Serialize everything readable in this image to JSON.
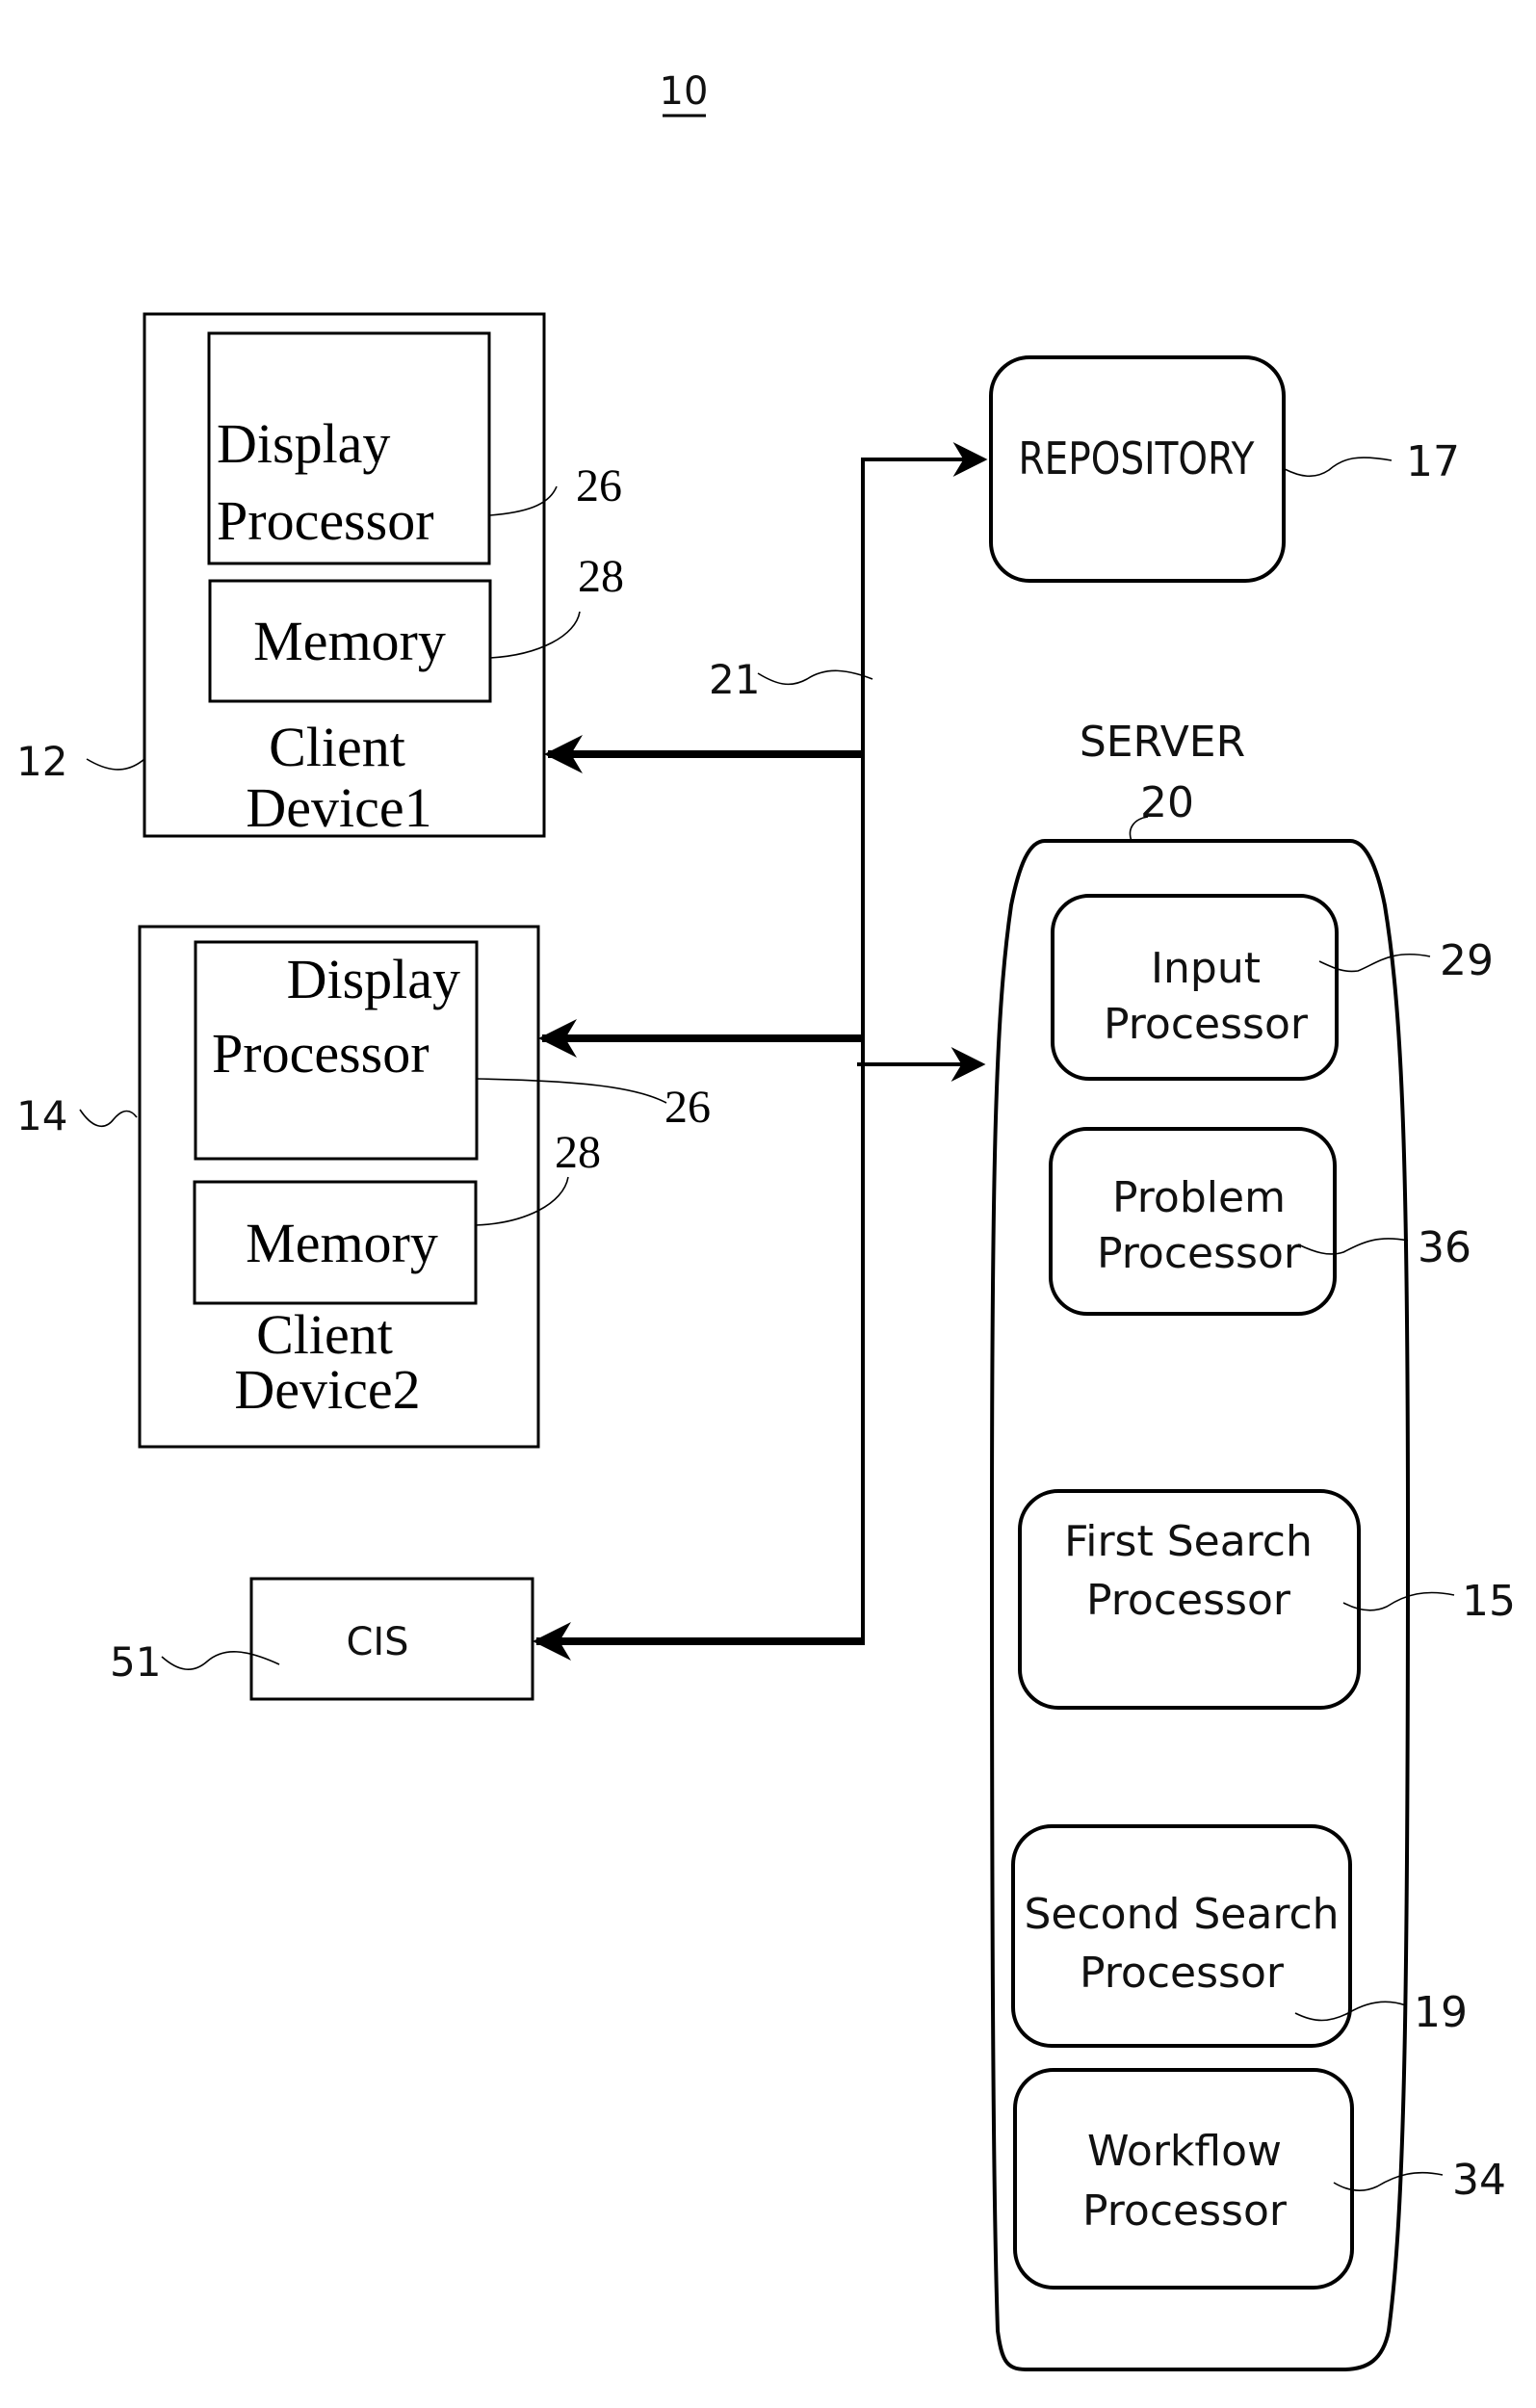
{
  "figure": {
    "number": "10"
  },
  "client_device_1": {
    "ref": "12",
    "title_line1": "Client",
    "title_line2": "Device1",
    "display_processor": {
      "line1": "Display",
      "line2": "Processor",
      "ref": "26"
    },
    "memory": {
      "label": "Memory",
      "ref": "28"
    }
  },
  "client_device_2": {
    "ref": "14",
    "title_line1": "Client",
    "title_line2": "Device2",
    "display_processor": {
      "line1": "Display",
      "line2": "Processor",
      "ref": "26"
    },
    "memory": {
      "label": "Memory",
      "ref": "28"
    }
  },
  "cis": {
    "label": "CIS",
    "ref": "51"
  },
  "network": {
    "ref": "21"
  },
  "repository": {
    "label": "REPOSITORY",
    "ref": "17"
  },
  "server": {
    "label": "SERVER",
    "ref": "20",
    "processors": [
      {
        "line1": "Input",
        "line2": "Processor",
        "ref": "29"
      },
      {
        "line1": "Problem",
        "line2": "Processor",
        "ref": "36"
      },
      {
        "line1": "First Search",
        "line2": "Processor",
        "ref": "15"
      },
      {
        "line1": "Second Search",
        "line2": "Processor",
        "ref": "19"
      },
      {
        "line1": "Workflow",
        "line2": "Processor",
        "ref": "34"
      }
    ]
  },
  "colors": {
    "ink": "#000000",
    "background": "#ffffff"
  }
}
